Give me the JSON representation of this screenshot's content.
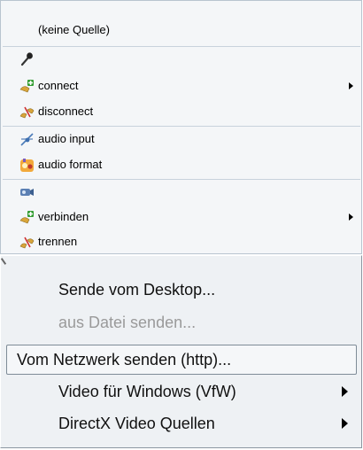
{
  "top_menu": {
    "header_label": "(keine Quelle)",
    "items_group1": [
      {
        "icon": "microphone-icon",
        "label": ""
      },
      {
        "icon": "connect-plug-icon",
        "label": "connect",
        "submenu": true
      },
      {
        "icon": "disconnect-plug-icon",
        "label": "disconnect"
      }
    ],
    "items_group2": [
      {
        "icon": "audio-input-icon",
        "label": "audio input"
      },
      {
        "icon": "audio-format-icon",
        "label": "audio format"
      }
    ],
    "items_group3": [
      {
        "icon": "video-camera-icon",
        "label": ""
      },
      {
        "icon": "connect-plug-icon",
        "label": "verbinden",
        "submenu": true
      },
      {
        "icon": "disconnect-plug-icon",
        "label": "trennen"
      }
    ]
  },
  "bottom_menu": {
    "items": [
      {
        "label": "Sende vom Desktop...",
        "state": "enabled"
      },
      {
        "label": "aus Datei senden...",
        "state": "disabled"
      },
      {
        "label": "Vom Netzwerk senden (http)...",
        "state": "highlighted"
      },
      {
        "label": "Video für Windows (VfW)",
        "submenu": true
      },
      {
        "label": "DirectX Video Quellen",
        "submenu": true
      }
    ]
  },
  "colors": {
    "menu_bg": "#f4f6f8",
    "separator": "#c8d2dc",
    "disabled_text": "#9a9a9a",
    "highlight_border": "#7e8b97"
  }
}
